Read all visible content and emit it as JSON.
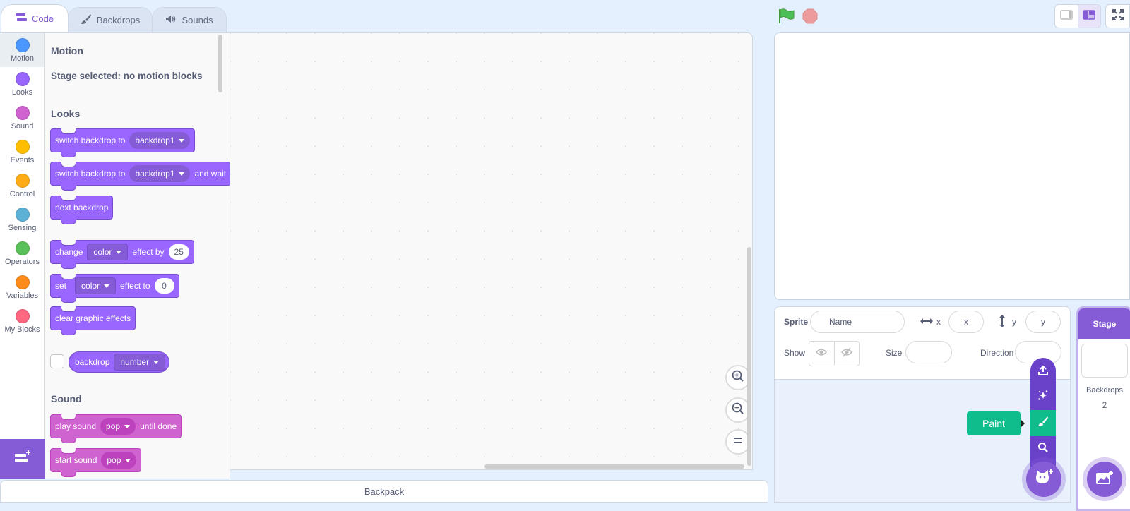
{
  "tabs": [
    {
      "label": "Code",
      "icon": "code-icon",
      "active": true
    },
    {
      "label": "Backdrops",
      "icon": "brush-icon",
      "active": false
    },
    {
      "label": "Sounds",
      "icon": "speaker-icon",
      "active": false
    }
  ],
  "categories": [
    {
      "label": "Motion",
      "color": "#4c97ff",
      "selected": true
    },
    {
      "label": "Looks",
      "color": "#9966ff"
    },
    {
      "label": "Sound",
      "color": "#cf63cf"
    },
    {
      "label": "Events",
      "color": "#ffbf00"
    },
    {
      "label": "Control",
      "color": "#ffab19"
    },
    {
      "label": "Sensing",
      "color": "#5cb1d6"
    },
    {
      "label": "Operators",
      "color": "#59c059"
    },
    {
      "label": "Variables",
      "color": "#ff8c1a"
    },
    {
      "label": "My Blocks",
      "color": "#ff6680"
    }
  ],
  "flyout": {
    "motion_heading": "Motion",
    "motion_note": "Stage selected: no motion blocks",
    "looks_heading": "Looks",
    "sound_heading": "Sound",
    "blocks": {
      "switch_backdrop": {
        "text": "switch backdrop to",
        "value": "backdrop1"
      },
      "switch_backdrop_wait": {
        "text": "switch backdrop to",
        "value": "backdrop1",
        "suffix": "and wait"
      },
      "next_backdrop": {
        "text": "next backdrop"
      },
      "change_effect": {
        "text": "change",
        "value": "color",
        "middle": "effect by",
        "num": "25"
      },
      "set_effect": {
        "text": "set",
        "value": "color",
        "middle": "effect to",
        "num": "0"
      },
      "clear_effects": {
        "text": "clear graphic effects"
      },
      "backdrop_reporter": {
        "text": "backdrop",
        "value": "number"
      },
      "play_sound": {
        "text": "play sound",
        "value": "pop",
        "suffix": "until done"
      },
      "start_sound": {
        "text": "start sound",
        "value": "pop"
      }
    }
  },
  "backpack": {
    "label": "Backpack"
  },
  "sprite_info": {
    "sprite_label": "Sprite",
    "name_placeholder": "Name",
    "x_label": "x",
    "x_placeholder": "x",
    "y_label": "y",
    "y_placeholder": "y",
    "show_label": "Show",
    "size_label": "Size",
    "direction_label": "Direction"
  },
  "stage_pane": {
    "header": "Stage",
    "backdrops_label": "Backdrops",
    "backdrops_count": "2"
  },
  "sprite_menu": {
    "tooltip": "Paint",
    "items": [
      "upload-icon",
      "surprise-icon",
      "paint-icon",
      "search-icon"
    ],
    "highlighted": "paint"
  },
  "colors": {
    "accent": "#855cd6",
    "looks": "#9966ff",
    "sound": "#cf63cf",
    "paint": "#0fbd8c"
  }
}
